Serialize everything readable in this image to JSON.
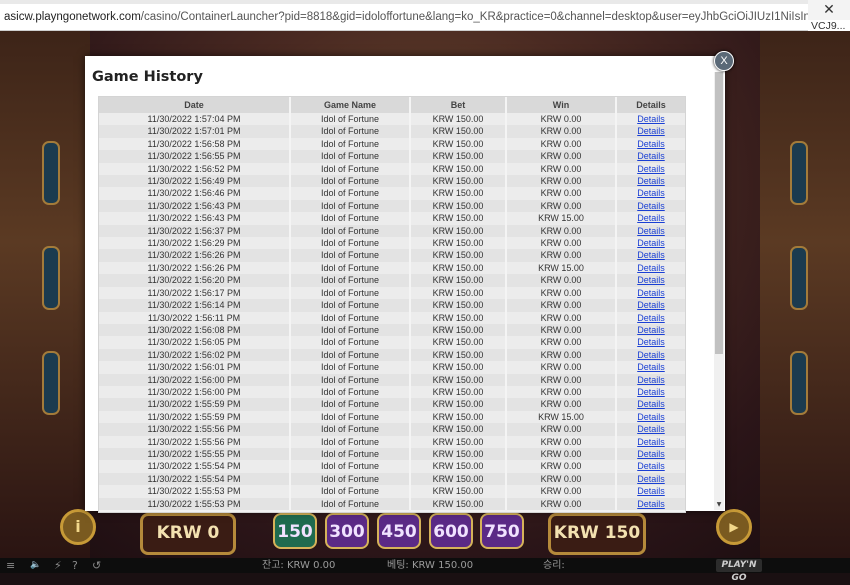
{
  "browser": {
    "url_host": "asicw.playngonetwork.com",
    "url_path": "/casino/ContainerLauncher?pid=8818&gid=idoloffortune&lang=ko_KR&practice=0&channel=desktop&user=eyJhbGciOiJIUzI1NiIsInR5cCI6IkpXVCJ",
    "url_overflow": "VCJ9...",
    "close_glyph": "✕"
  },
  "modal": {
    "title": "Game History",
    "close_label": "X",
    "columns": [
      "Date",
      "Game Name",
      "Bet",
      "Win",
      "Details"
    ],
    "rows": [
      [
        "11/30/2022 1:57:04 PM",
        "Idol of Fortune",
        "KRW 150.00",
        "KRW 0.00",
        "Details"
      ],
      [
        "11/30/2022 1:57:01 PM",
        "Idol of Fortune",
        "KRW 150.00",
        "KRW 0.00",
        "Details"
      ],
      [
        "11/30/2022 1:56:58 PM",
        "Idol of Fortune",
        "KRW 150.00",
        "KRW 0.00",
        "Details"
      ],
      [
        "11/30/2022 1:56:55 PM",
        "Idol of Fortune",
        "KRW 150.00",
        "KRW 0.00",
        "Details"
      ],
      [
        "11/30/2022 1:56:52 PM",
        "Idol of Fortune",
        "KRW 150.00",
        "KRW 0.00",
        "Details"
      ],
      [
        "11/30/2022 1:56:49 PM",
        "Idol of Fortune",
        "KRW 150.00",
        "KRW 0.00",
        "Details"
      ],
      [
        "11/30/2022 1:56:46 PM",
        "Idol of Fortune",
        "KRW 150.00",
        "KRW 0.00",
        "Details"
      ],
      [
        "11/30/2022 1:56:43 PM",
        "Idol of Fortune",
        "KRW 150.00",
        "KRW 0.00",
        "Details"
      ],
      [
        "11/30/2022 1:56:43 PM",
        "Idol of Fortune",
        "KRW 150.00",
        "KRW 15.00",
        "Details"
      ],
      [
        "11/30/2022 1:56:37 PM",
        "Idol of Fortune",
        "KRW 150.00",
        "KRW 0.00",
        "Details"
      ],
      [
        "11/30/2022 1:56:29 PM",
        "Idol of Fortune",
        "KRW 150.00",
        "KRW 0.00",
        "Details"
      ],
      [
        "11/30/2022 1:56:26 PM",
        "Idol of Fortune",
        "KRW 150.00",
        "KRW 0.00",
        "Details"
      ],
      [
        "11/30/2022 1:56:26 PM",
        "Idol of Fortune",
        "KRW 150.00",
        "KRW 15.00",
        "Details"
      ],
      [
        "11/30/2022 1:56:20 PM",
        "Idol of Fortune",
        "KRW 150.00",
        "KRW 0.00",
        "Details"
      ],
      [
        "11/30/2022 1:56:17 PM",
        "Idol of Fortune",
        "KRW 150.00",
        "KRW 0.00",
        "Details"
      ],
      [
        "11/30/2022 1:56:14 PM",
        "Idol of Fortune",
        "KRW 150.00",
        "KRW 0.00",
        "Details"
      ],
      [
        "11/30/2022 1:56:11 PM",
        "Idol of Fortune",
        "KRW 150.00",
        "KRW 0.00",
        "Details"
      ],
      [
        "11/30/2022 1:56:08 PM",
        "Idol of Fortune",
        "KRW 150.00",
        "KRW 0.00",
        "Details"
      ],
      [
        "11/30/2022 1:56:05 PM",
        "Idol of Fortune",
        "KRW 150.00",
        "KRW 0.00",
        "Details"
      ],
      [
        "11/30/2022 1:56:02 PM",
        "Idol of Fortune",
        "KRW 150.00",
        "KRW 0.00",
        "Details"
      ],
      [
        "11/30/2022 1:56:01 PM",
        "Idol of Fortune",
        "KRW 150.00",
        "KRW 0.00",
        "Details"
      ],
      [
        "11/30/2022 1:56:00 PM",
        "Idol of Fortune",
        "KRW 150.00",
        "KRW 0.00",
        "Details"
      ],
      [
        "11/30/2022 1:56:00 PM",
        "Idol of Fortune",
        "KRW 150.00",
        "KRW 0.00",
        "Details"
      ],
      [
        "11/30/2022 1:55:59 PM",
        "Idol of Fortune",
        "KRW 150.00",
        "KRW 0.00",
        "Details"
      ],
      [
        "11/30/2022 1:55:59 PM",
        "Idol of Fortune",
        "KRW 150.00",
        "KRW 15.00",
        "Details"
      ],
      [
        "11/30/2022 1:55:56 PM",
        "Idol of Fortune",
        "KRW 150.00",
        "KRW 0.00",
        "Details"
      ],
      [
        "11/30/2022 1:55:56 PM",
        "Idol of Fortune",
        "KRW 150.00",
        "KRW 0.00",
        "Details"
      ],
      [
        "11/30/2022 1:55:55 PM",
        "Idol of Fortune",
        "KRW 150.00",
        "KRW 0.00",
        "Details"
      ],
      [
        "11/30/2022 1:55:54 PM",
        "Idol of Fortune",
        "KRW 150.00",
        "KRW 0.00",
        "Details"
      ],
      [
        "11/30/2022 1:55:54 PM",
        "Idol of Fortune",
        "KRW 150.00",
        "KRW 0.00",
        "Details"
      ],
      [
        "11/30/2022 1:55:53 PM",
        "Idol of Fortune",
        "KRW 150.00",
        "KRW 0.00",
        "Details"
      ],
      [
        "11/30/2022 1:55:53 PM",
        "Idol of Fortune",
        "KRW 150.00",
        "KRW 0.00",
        "Details"
      ]
    ],
    "scroll_down_glyph": "▼"
  },
  "game": {
    "info_glyph": "i",
    "balance_display": "KRW 0",
    "bet_chips": [
      "150",
      "300",
      "450",
      "600",
      "750"
    ],
    "bet_display": "KRW 150",
    "play_glyph": "▶",
    "colors": {
      "chip_green": "#1f6b4f",
      "chip_purple": "#5b2a86",
      "gold": "#c79a37"
    }
  },
  "statusbar": {
    "menu_icon": "≡",
    "sound_icon": "🔈",
    "turbo_icon": "⚡",
    "help_icon": "?",
    "history_icon": "↺",
    "balance_label": "잔고: KRW 0.00",
    "bet_label": "베팅: KRW 150.00",
    "win_label": "승리:",
    "logo_text": "PLAY'N GO"
  }
}
